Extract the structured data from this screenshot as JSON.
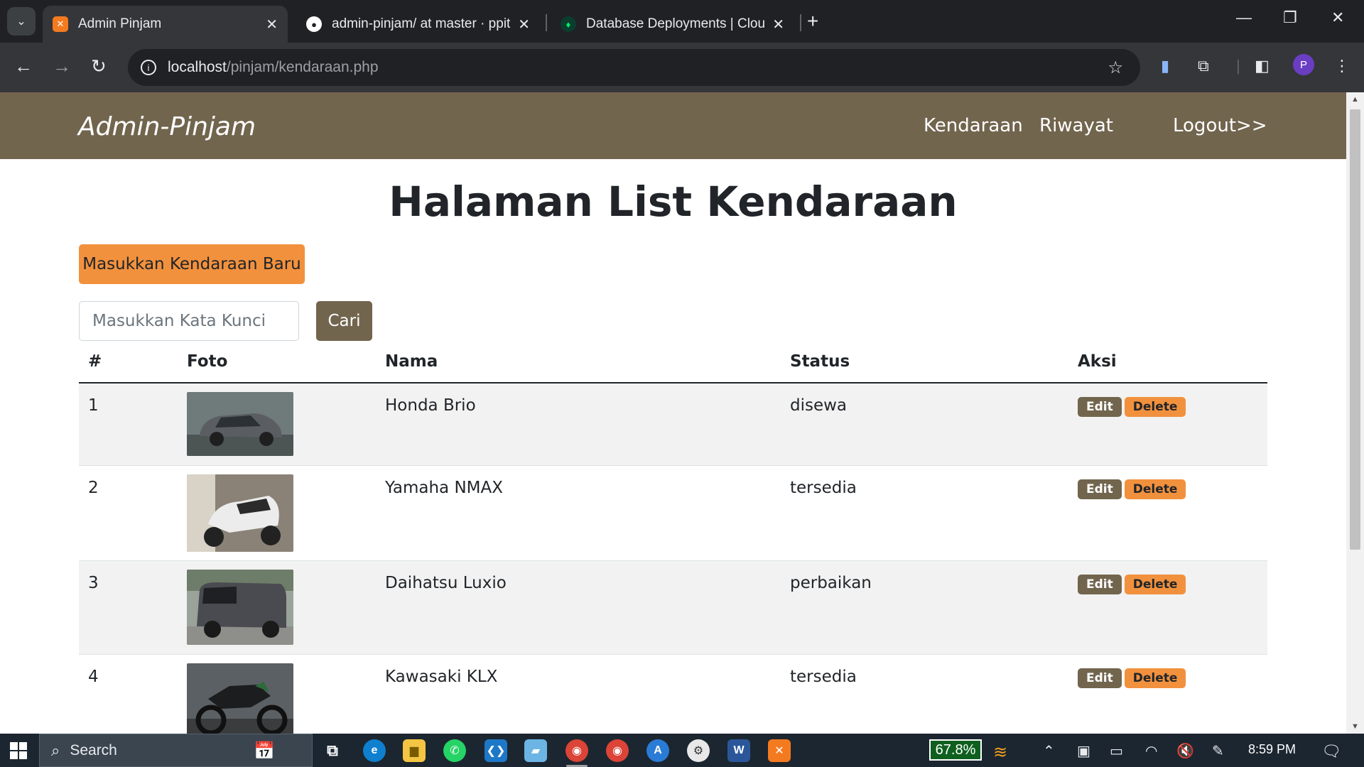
{
  "browser": {
    "tabs": [
      {
        "title": "Admin Pinjam",
        "active": true,
        "favicon": "xampp-icon"
      },
      {
        "title": "admin-pinjam/ at master · ppitr",
        "active": false,
        "favicon": "github-icon"
      },
      {
        "title": "Database Deployments | Cloud:",
        "active": false,
        "favicon": "mongodb-icon"
      }
    ],
    "url_host": "localhost",
    "url_path": "/pinjam/kendaraan.php",
    "profile_initial": "P"
  },
  "site": {
    "brand": "Admin-Pinjam",
    "nav": {
      "kendaraan": "Kendaraan",
      "riwayat": "Riwayat",
      "logout": "Logout>>"
    }
  },
  "page": {
    "title": "Halaman List Kendaraan",
    "new_button": "Masukkan Kendaraan Baru",
    "search_placeholder": "Masukkan Kata Kunci",
    "search_button": "Cari"
  },
  "table": {
    "headers": {
      "no": "#",
      "foto": "Foto",
      "nama": "Nama",
      "status": "Status",
      "aksi": "Aksi"
    },
    "rows": [
      {
        "no": "1",
        "nama": "Honda Brio",
        "status": "disewa",
        "edit": "Edit",
        "delete": "Delete"
      },
      {
        "no": "2",
        "nama": "Yamaha NMAX",
        "status": "tersedia",
        "edit": "Edit",
        "delete": "Delete"
      },
      {
        "no": "3",
        "nama": "Daihatsu Luxio",
        "status": "perbaikan",
        "edit": "Edit",
        "delete": "Delete"
      },
      {
        "no": "4",
        "nama": "Kawasaki KLX",
        "status": "tersedia",
        "edit": "Edit",
        "delete": "Delete"
      }
    ]
  },
  "taskbar": {
    "search_label": "Search",
    "battery_percent": "67.8%",
    "time": "8:59 PM"
  },
  "colors": {
    "brand": "#72654e",
    "accent": "#f2913d"
  }
}
